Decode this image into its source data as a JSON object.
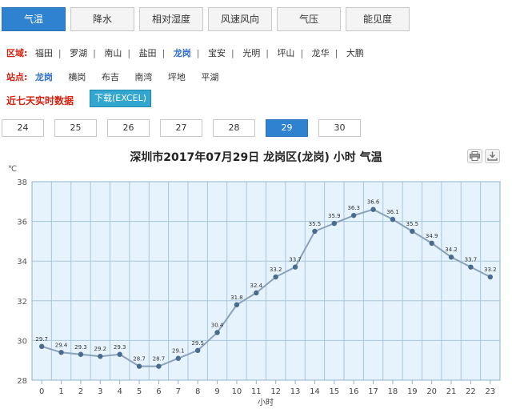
{
  "tabs": [
    {
      "label": "气温",
      "active": true
    },
    {
      "label": "降水",
      "active": false
    },
    {
      "label": "相对湿度",
      "active": false
    },
    {
      "label": "风速风向",
      "active": false
    },
    {
      "label": "气压",
      "active": false
    },
    {
      "label": "能见度",
      "active": false
    }
  ],
  "district": {
    "label": "区域:",
    "items": [
      {
        "label": "福田",
        "active": false
      },
      {
        "label": "罗湖",
        "active": false
      },
      {
        "label": "南山",
        "active": false
      },
      {
        "label": "盐田",
        "active": false
      },
      {
        "label": "龙岗",
        "active": true
      },
      {
        "label": "宝安",
        "active": false
      },
      {
        "label": "光明",
        "active": false
      },
      {
        "label": "坪山",
        "active": false
      },
      {
        "label": "龙华",
        "active": false
      },
      {
        "label": "大鹏",
        "active": false
      }
    ]
  },
  "station": {
    "label": "站点:",
    "items": [
      {
        "label": "龙岗",
        "active": true
      },
      {
        "label": "横岗",
        "active": false
      },
      {
        "label": "布吉",
        "active": false
      },
      {
        "label": "南湾",
        "active": false
      },
      {
        "label": "坪地",
        "active": false
      },
      {
        "label": "平湖",
        "active": false
      }
    ]
  },
  "recent_label": "近七天实时数据",
  "download_label": "下载(EXCEL)",
  "days": [
    {
      "label": "24",
      "active": false
    },
    {
      "label": "25",
      "active": false
    },
    {
      "label": "26",
      "active": false
    },
    {
      "label": "27",
      "active": false
    },
    {
      "label": "28",
      "active": false
    },
    {
      "label": "29",
      "active": true
    },
    {
      "label": "30",
      "active": false
    }
  ],
  "colors": {
    "accent": "#2f82cf",
    "plot_background": "#e6f3fc",
    "series_line": "#8aa1b9",
    "marker": "#4a6b8e",
    "alert_text": "#d9200f"
  },
  "toolbar_icons": [
    "print-icon",
    "download-icon"
  ],
  "chart_data": {
    "type": "line",
    "title": "深圳市2017年07月29日 龙岗区(龙岗) 小时 气温",
    "xlabel": "小时",
    "ylabel": "℃",
    "x": [
      0,
      1,
      2,
      3,
      4,
      5,
      6,
      7,
      8,
      9,
      10,
      11,
      12,
      13,
      14,
      15,
      16,
      17,
      18,
      19,
      20,
      21,
      22,
      23
    ],
    "series": [
      {
        "values": [
          29.7,
          29.4,
          29.3,
          29.2,
          29.3,
          28.7,
          28.7,
          29.1,
          29.5,
          30.4,
          31.8,
          32.4,
          33.2,
          33.7,
          35.5,
          35.9,
          36.3,
          36.6,
          36.1,
          35.5,
          34.9,
          34.2,
          33.7,
          33.2
        ],
        "labels": [
          "29.7",
          "29.4",
          "29.3",
          "29.2",
          "29.3",
          "28.7",
          "28.7",
          "29.1",
          "29.5",
          "30.4",
          "31.8",
          "32.4",
          "33.2",
          "33.7",
          "35.5",
          "35.9",
          "36.3",
          "36.6",
          "36.1",
          "35.5",
          "34.9",
          "34.2",
          "33.7",
          "33.2"
        ]
      }
    ],
    "ylim": [
      28,
      38
    ],
    "yticks": [
      "28",
      "30",
      "32",
      "34",
      "36",
      "38"
    ],
    "xticks": [
      "0",
      "1",
      "2",
      "3",
      "4",
      "5",
      "6",
      "7",
      "8",
      "9",
      "10",
      "11",
      "12",
      "13",
      "14",
      "15",
      "16",
      "17",
      "18",
      "19",
      "20",
      "21",
      "22",
      "23"
    ],
    "grid": true,
    "legend": "none"
  }
}
